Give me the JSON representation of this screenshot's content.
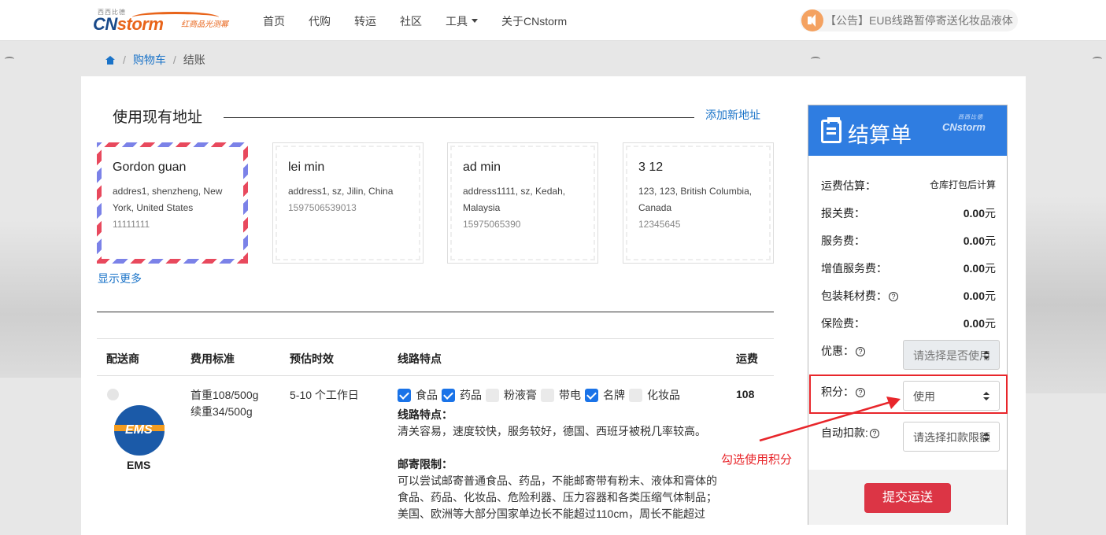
{
  "header": {
    "logo_small": "西西比德",
    "logo_cn": "CN",
    "logo_storm": "storm",
    "logo_slogan": "红商品光测幂",
    "nav": [
      "首页",
      "代购",
      "转运",
      "社区",
      "工具",
      "关于CNstorm"
    ],
    "notice": "【公告】EUB线路暂停寄送化妆品液体"
  },
  "breadcrumb": {
    "cart": "购物车",
    "current": "结账",
    "sep": "/"
  },
  "address": {
    "title": "使用现有地址",
    "add_link": "添加新地址",
    "show_more": "显示更多",
    "cards": [
      {
        "name": "Gordon guan",
        "address": "addres1, shenzheng, New York, United States",
        "phone": "11111111",
        "selected": true
      },
      {
        "name": "lei min",
        "address": "address1, sz, Jilin, China",
        "phone": "1597506539013",
        "selected": false
      },
      {
        "name": "ad min",
        "address": "address1111, sz, Kedah, Malaysia",
        "phone": "15975065390",
        "selected": false
      },
      {
        "name": "3 12",
        "address": "123, 123, British Columbia, Canada",
        "phone": "12345645",
        "selected": false
      }
    ]
  },
  "shipping": {
    "headers": {
      "carrier": "配送商",
      "standard": "费用标准",
      "eta": "预估时效",
      "features": "线路特点",
      "fee": "运费"
    },
    "row": {
      "carrier": "EMS",
      "logo_text": "EMS",
      "first_weight": "首重108/500g",
      "cont_weight": "续重34/500g",
      "eta": "5-10 个工作日",
      "checks": [
        {
          "label": "食品",
          "checked": true
        },
        {
          "label": "药品",
          "checked": true
        },
        {
          "label": "粉液膏",
          "checked": false
        },
        {
          "label": "带电",
          "checked": false
        },
        {
          "label": "名牌",
          "checked": true
        },
        {
          "label": "化妆品",
          "checked": false
        }
      ],
      "feat_h1": "线路特点：",
      "feat_p1": "清关容易，速度较快，服务较好，德国、西班牙被税几率较高。",
      "feat_h2": "邮寄限制：",
      "feat_p2": "可以尝试邮寄普通食品、药品，不能邮寄带有粉末、液体和膏体的食品、药品、化妆品、危险利器、压力容器和各类压缩气体制品；",
      "feat_p3": "美国、欧洲等大部分国家单边长不能超过110cm，周长不能超过",
      "fee": "108"
    }
  },
  "summary": {
    "title": "结算单",
    "brand_small": "西西比德",
    "brand": "CNstorm",
    "rows": {
      "shipping_label": "运费估算：",
      "shipping_value": "仓库打包后计算",
      "customs_label": "报关费：",
      "customs_value": "0.00",
      "service_label": "服务费：",
      "service_value": "0.00",
      "vas_label": "增值服务费：",
      "vas_value": "0.00",
      "pack_label": "包装耗材费：",
      "pack_value": "0.00",
      "insure_label": "保险费：",
      "insure_value": "0.00",
      "unit": "元",
      "discount_label": "优惠：",
      "discount_select": "请选择是否使用",
      "points_label": "积分：",
      "points_select": "使用",
      "auto_label": "自动扣款:",
      "auto_select": "请选择扣款限额"
    },
    "submit": "提交运送",
    "qmark": "?"
  },
  "annotation": {
    "text": "勾选使用积分",
    "color": "#e8262b"
  },
  "colors": {
    "primary": "#2f7de1",
    "link": "#1a73c8",
    "danger": "#dc3545"
  }
}
